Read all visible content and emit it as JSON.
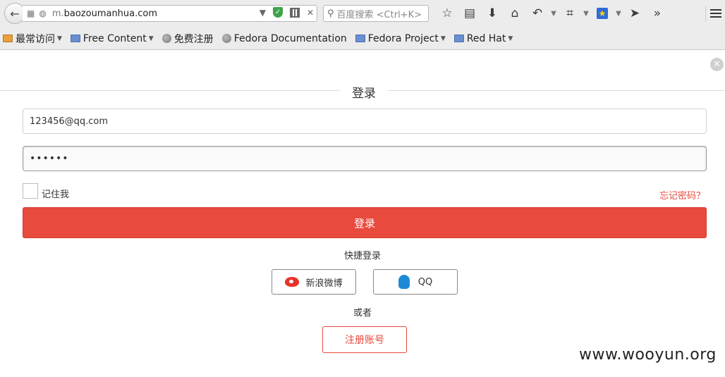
{
  "browser": {
    "url_prefix": "m.",
    "url_domain": "baozoumanhua.com",
    "search_placeholder": "百度搜索 <Ctrl+K>",
    "bookmarks": [
      {
        "label": "最常访问",
        "type": "smart-folder"
      },
      {
        "label": "Free Content",
        "type": "folder"
      },
      {
        "label": "免费注册",
        "type": "page"
      },
      {
        "label": "Fedora Documentation",
        "type": "page"
      },
      {
        "label": "Fedora Project",
        "type": "folder"
      },
      {
        "label": "Red Hat",
        "type": "folder"
      }
    ]
  },
  "login": {
    "title": "登录",
    "email_value": "123456@qq.com",
    "password_value": "••••••",
    "remember_label": "记住我",
    "forgot_label": "忘记密码？",
    "login_button": "登录",
    "quick_login_label": "快捷登录",
    "weibo_label": "新浪微博",
    "qq_label": "QQ",
    "or_label": "或者",
    "register_button": "注册账号"
  },
  "watermark": "www.wooyun.org",
  "colors": {
    "accent": "#e84a3d",
    "weibo": "#e6332a",
    "qq": "#1e8ad6"
  }
}
